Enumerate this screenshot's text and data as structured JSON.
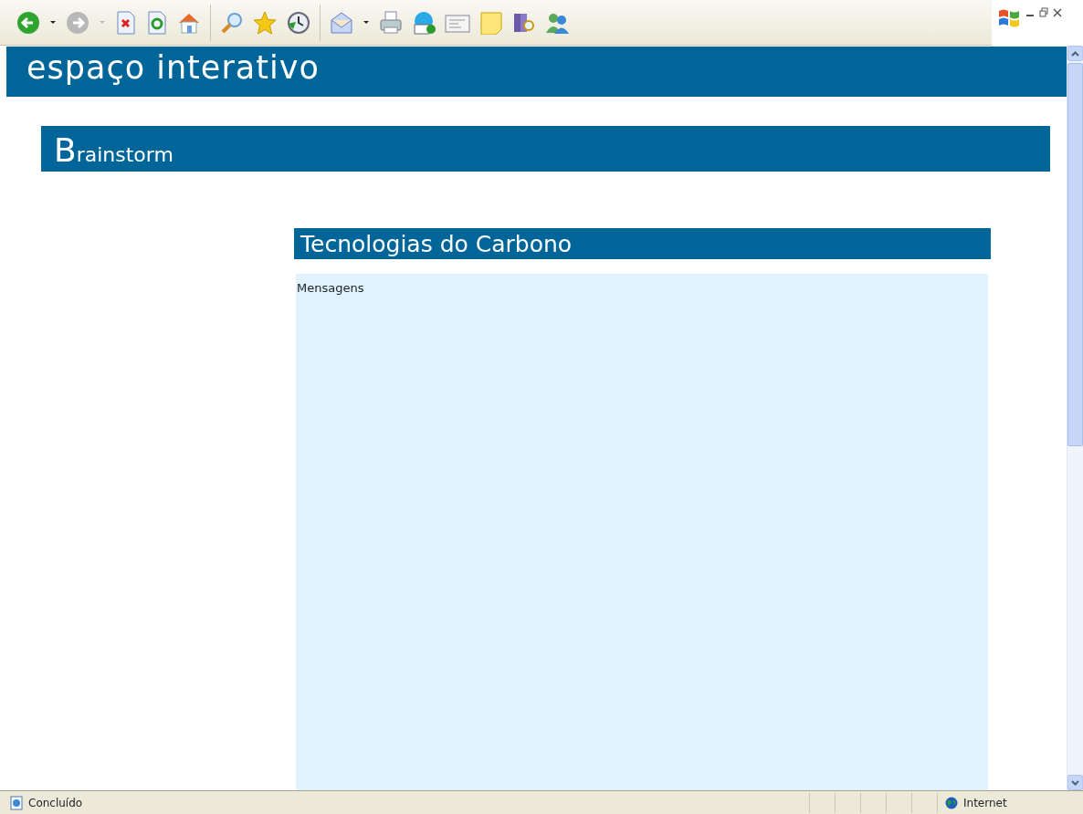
{
  "site_title": "espaço interativo",
  "section_title": "Brainstorm",
  "topic_title": "Tecnologias do Carbono",
  "messages_label": "Mensagens",
  "status_bar": {
    "message": "Concluído",
    "zone": "Internet"
  }
}
